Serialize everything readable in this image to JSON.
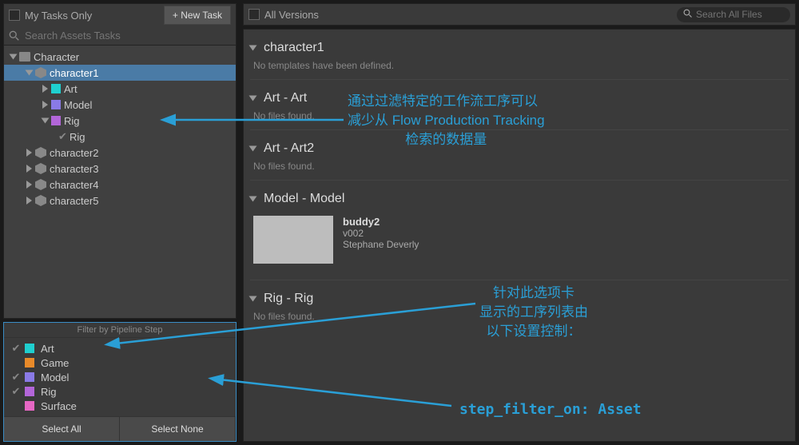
{
  "left": {
    "my_tasks_label": "My Tasks Only",
    "new_task_btn": "+ New Task",
    "search_placeholder": "Search Assets Tasks",
    "tree": {
      "root": "Character",
      "char1": "character1",
      "art": "Art",
      "model": "Model",
      "rig": "Rig",
      "rig_task": "Rig",
      "char2": "character2",
      "char3": "character3",
      "char4": "character4",
      "char5": "character5"
    },
    "filter_title": "Filter by Pipeline Step",
    "steps": {
      "art": "Art",
      "game": "Game",
      "model": "Model",
      "rig": "Rig",
      "surface": "Surface"
    },
    "colors": {
      "art": "#1fcfcf",
      "game": "#e88a2a",
      "model": "#8a7ae6",
      "rig": "#b366d9",
      "surface": "#e667c3"
    },
    "select_all": "Select All",
    "select_none": "Select None"
  },
  "right": {
    "all_versions": "All Versions",
    "search_placeholder": "Search All Files",
    "sections": {
      "char1": {
        "title": "character1",
        "sub": "No templates have been defined."
      },
      "artart": {
        "title": "Art - Art",
        "sub": "No files found."
      },
      "artart2": {
        "title": "Art - Art2",
        "sub": "No files found."
      },
      "modelmodel": {
        "title": "Model - Model"
      },
      "rigrig": {
        "title": "Rig - Rig",
        "sub": "No files found."
      }
    },
    "file": {
      "name": "buddy2",
      "version": "v002",
      "user": "Stephane Deverly"
    }
  },
  "annotations": {
    "a1_l1": "通过过滤特定的工作流工序可以",
    "a1_l2": "减少从 Flow Production Tracking",
    "a1_l3": "检索的数据量",
    "a2_l1": "针对此选项卡",
    "a2_l2": "显示的工序列表由",
    "a2_l3": "以下设置控制：",
    "a3": "step_filter_on: Asset"
  }
}
